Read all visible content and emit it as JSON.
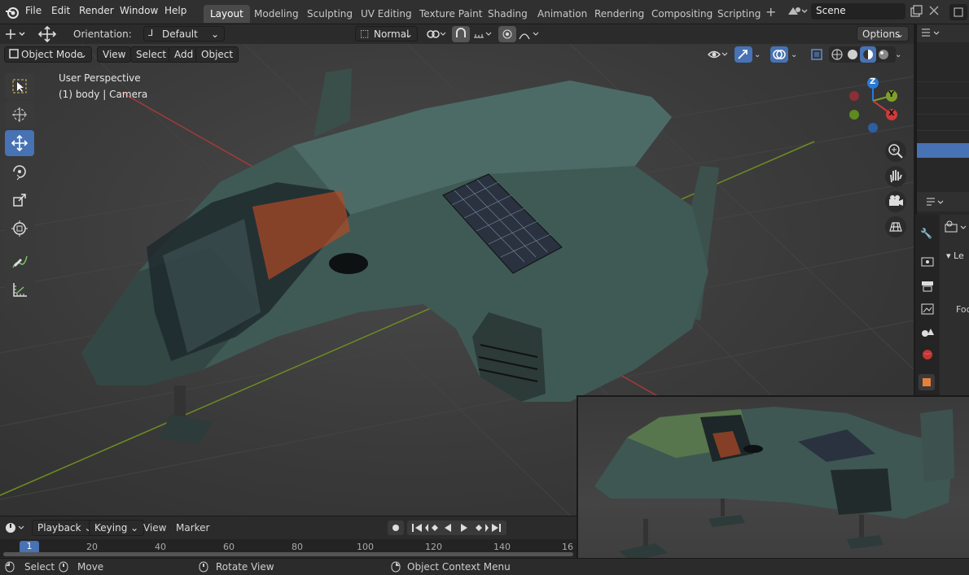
{
  "menu": {
    "file": "File",
    "edit": "Edit",
    "render": "Render",
    "window": "Window",
    "help": "Help"
  },
  "workspaces": [
    "Layout",
    "Modeling",
    "Sculpting",
    "UV Editing",
    "Texture Paint",
    "Shading",
    "Animation",
    "Rendering",
    "Compositing",
    "Scripting"
  ],
  "scene": {
    "value": "Scene"
  },
  "header": {
    "orientation_label": "Orientation:",
    "orientation_value": "Default",
    "pivot_value": "Normal",
    "options_label": "Options"
  },
  "mode_bar": {
    "mode": "Object Mode",
    "view": "View",
    "select": "Select",
    "add": "Add",
    "object": "Object"
  },
  "viewport": {
    "perspective": "User Perspective",
    "info": "(1) body | Camera"
  },
  "gizmo": {
    "z": "Z",
    "y": "Y",
    "x": "X"
  },
  "properties": {
    "section": "Le",
    "field": "Foc"
  },
  "timeline": {
    "playback": "Playback",
    "keying": "Keying",
    "view": "View",
    "marker": "Marker",
    "current_frame": "1",
    "ruler": [
      "20",
      "40",
      "60",
      "80",
      "100",
      "120",
      "140",
      "16"
    ]
  },
  "status": {
    "select": "Select",
    "move": "Move",
    "rotate_view": "Rotate View",
    "context_menu": "Object Context Menu"
  },
  "colors": {
    "accent": "#4772b3",
    "x_axis": "#d03a3a",
    "y_axis": "#7ea02a",
    "z_axis": "#2a79d6"
  }
}
